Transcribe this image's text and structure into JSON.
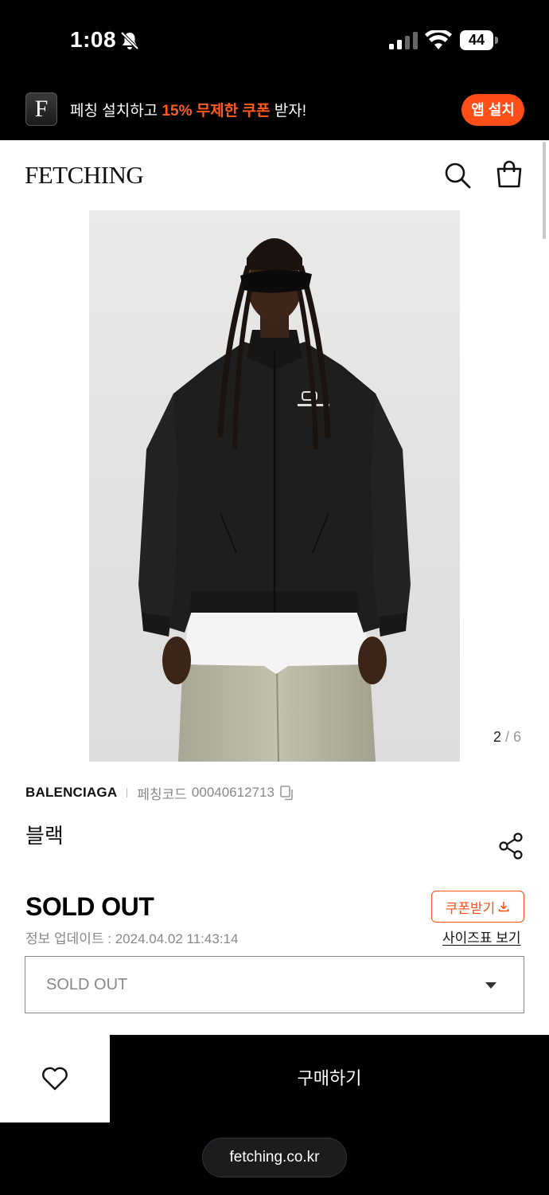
{
  "status_bar": {
    "time": "1:08",
    "battery": "44"
  },
  "app_banner": {
    "logo_letter": "F",
    "text_before": "페칭 설치하고 ",
    "text_highlight": "15% 무제한 쿠폰",
    "text_after": " 받자!",
    "install_label": "앱 설치",
    "accent_color": "#ff4e17"
  },
  "header": {
    "logo": "FETCHING"
  },
  "gallery": {
    "current": "2",
    "separator": "/",
    "total": "6"
  },
  "product": {
    "brand": "BALENCIAGA",
    "code_label": "페칭코드",
    "code_value": "00040612713",
    "color_name": "블랙",
    "status": "SOLD OUT",
    "update_info": "정보 업데이트 : 2024.04.02 11:43:14",
    "coupon_label": "쿠폰받기",
    "size_chart_label": "사이즈표 보기",
    "option_value": "SOLD OUT"
  },
  "bottom_bar": {
    "buy_label": "구매하기"
  },
  "browser": {
    "url": "fetching.co.kr"
  },
  "icons": [
    "bell-slash-icon",
    "signal-icon",
    "wifi-icon",
    "search-icon",
    "shopping-bag-icon",
    "copy-icon",
    "share-icon",
    "download-icon",
    "heart-icon",
    "chevron-down-icon"
  ]
}
